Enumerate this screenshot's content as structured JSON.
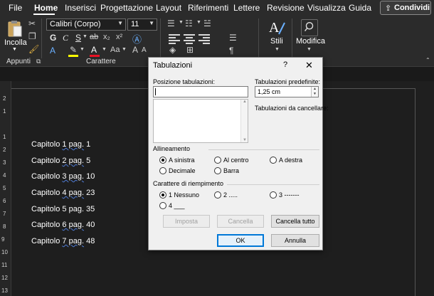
{
  "menu": {
    "items": [
      "File",
      "Home",
      "Inserisci",
      "Progettazione",
      "Layout",
      "Riferimenti",
      "Lettere",
      "Revisione",
      "Visualizza",
      "Guida"
    ],
    "active": "Home",
    "share_label": "Condividi"
  },
  "ribbon": {
    "paste_label": "Incolla",
    "clipboard_group": "Appunti",
    "font_group": "Carattere",
    "font_name": "Calibri (Corpo)",
    "font_size": "11",
    "bold": "G",
    "italic": "C",
    "underline": "S",
    "font_color_letter": "A",
    "highlight_letter": "A",
    "change_case": "Aa",
    "styles_label": "Stili",
    "edit_label": "Modifica",
    "colors": {
      "highlight": "#ffff00",
      "font_color": "#e81123",
      "accent": "#2b579a"
    }
  },
  "ruler": {
    "left_numbers": [
      "2",
      "1",
      "1",
      "2",
      "3",
      "4",
      "5",
      "6",
      "7",
      "8",
      "9",
      "10",
      "11",
      "12",
      "13"
    ]
  },
  "document": {
    "lines": [
      {
        "before": "Capitolo ",
        "sq": "1 pag.",
        "after": " 1"
      },
      {
        "before": "Capitolo ",
        "sq": "2 pag.",
        "after": " 5"
      },
      {
        "before": "Capitolo ",
        "sq": "3 pag.",
        "after": " 10"
      },
      {
        "before": "Capitolo ",
        "sq": "4 pag.",
        "after": " 23"
      },
      {
        "before": "Capitolo 5 pag. 35",
        "sq": "",
        "after": ""
      },
      {
        "before": "Capitolo ",
        "sq": "6 pag.",
        "after": " 40"
      },
      {
        "before": "Capitolo ",
        "sq": "7 pag.",
        "after": " 48"
      }
    ]
  },
  "dialog": {
    "title": "Tabulazioni",
    "help": "?",
    "close": "✕",
    "tab_position_label": "Posizione tabulazioni:",
    "tab_position_value": "",
    "default_tabs_label": "Tabulazioni predefinite:",
    "default_tabs_value": "1,25 cm",
    "tabs_to_clear_label": "Tabulazioni da cancellare:",
    "alignment_label": "Allineamento",
    "alignment_options": [
      "A sinistra",
      "Al centro",
      "A destra",
      "Decimale",
      "Barra"
    ],
    "alignment_selected": "A sinistra",
    "leader_label": "Carattere di riempimento",
    "leader_options": [
      "1 Nessuno",
      "2 .....",
      "3 -------",
      "4 ___"
    ],
    "leader_selected": "1 Nessuno",
    "buttons": {
      "set": "Imposta",
      "clear": "Cancella",
      "clear_all": "Cancella tutto",
      "ok": "OK",
      "cancel": "Annulla"
    }
  }
}
